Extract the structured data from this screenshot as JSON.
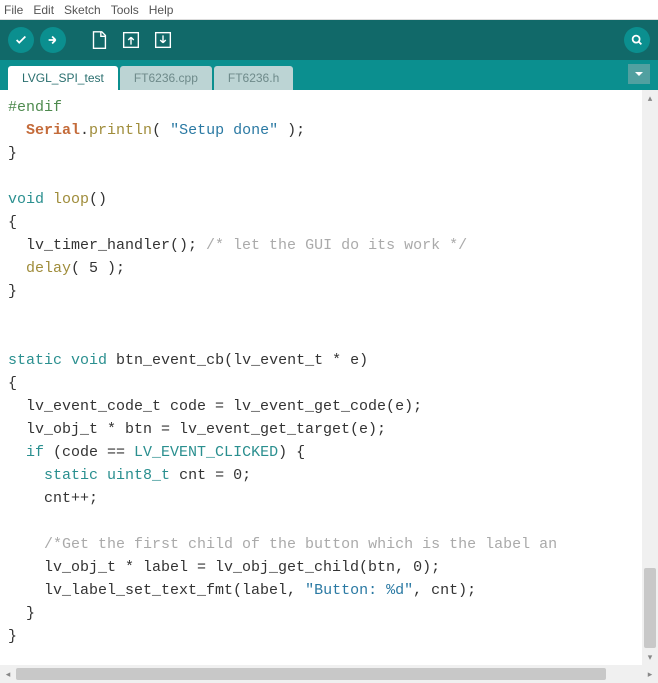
{
  "menu": {
    "file": "File",
    "edit": "Edit",
    "sketch": "Sketch",
    "tools": "Tools",
    "help": "Help"
  },
  "tabs": {
    "active": "LVGL_SPI_test",
    "t1": "FT6236.cpp",
    "t2": "FT6236.h"
  },
  "code": {
    "l01": "#endif",
    "l02a": "Serial",
    "l02b": ".",
    "l02c": "println",
    "l02d": "( ",
    "l02e": "\"Setup done\"",
    "l02f": " );",
    "l03": "}",
    "l04": "",
    "l05a": "void",
    "l05b": " ",
    "l05c": "loop",
    "l05d": "()",
    "l06": "{",
    "l07a": "  lv_timer_handler(); ",
    "l07b": "/* let the GUI do its work */",
    "l08a": "  ",
    "l08b": "delay",
    "l08c": "( 5 );",
    "l09": "}",
    "l10": "",
    "l11": "",
    "l12a": "static",
    "l12b": " ",
    "l12c": "void",
    "l12d": " btn_event_cb(lv_event_t * e)",
    "l13": "{",
    "l14": "  lv_event_code_t code = lv_event_get_code(e);",
    "l15": "  lv_obj_t * btn = lv_event_get_target(e);",
    "l16a": "  ",
    "l16b": "if",
    "l16c": " (code == ",
    "l16d": "LV_EVENT_CLICKED",
    "l16e": ") {",
    "l17a": "    ",
    "l17b": "static",
    "l17c": " ",
    "l17d": "uint8_t",
    "l17e": " cnt = 0;",
    "l18": "    cnt++;",
    "l19": "",
    "l20a": "    ",
    "l20b": "/*Get the first child of the button which is the label an",
    "l21": "    lv_obj_t * label = lv_obj_get_child(btn, 0);",
    "l22a": "    lv_label_set_text_fmt(label, ",
    "l22b": "\"Button: %d\"",
    "l22c": ", cnt);",
    "l23": "  }",
    "l24": "}"
  }
}
